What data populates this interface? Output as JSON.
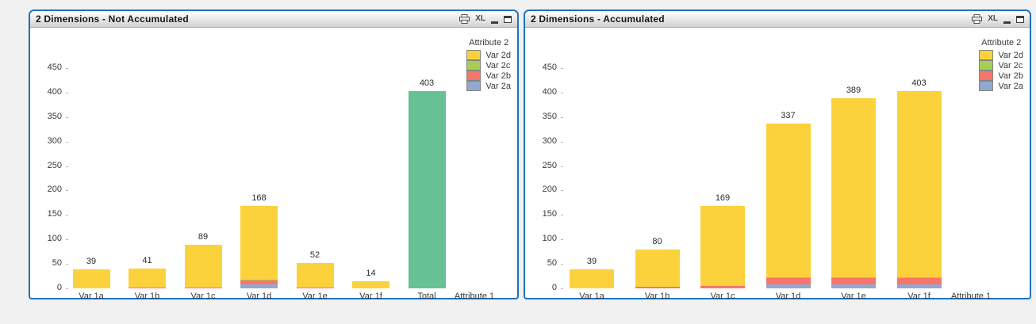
{
  "panels": [
    {
      "title": "2 Dimensions - Not Accumulated",
      "caption": {
        "xl_label": "XL"
      }
    },
    {
      "title": "2 Dimensions - Accumulated",
      "caption": {
        "xl_label": "XL"
      }
    }
  ],
  "chart_data": [
    {
      "type": "bar",
      "stacked": true,
      "title": "2 Dimensions - Not Accumulated",
      "xlabel": "Attribute 1",
      "ylabel": "",
      "ylim": [
        0,
        450
      ],
      "ytick_step": 50,
      "grid": false,
      "legend": {
        "title": "Attribute 2",
        "position": "top-right",
        "entries": [
          {
            "label": "Var 2d",
            "color": "#FCD23C"
          },
          {
            "label": "Var 2c",
            "color": "#A6CE53"
          },
          {
            "label": "Var 2b",
            "color": "#F7766B"
          },
          {
            "label": "Var 2a",
            "color": "#92A8CE"
          }
        ]
      },
      "series_colors": {
        "Var 2a": "#92A8CE",
        "Var 2b": "#F7766B",
        "Var 2c": "#A6CE53",
        "Var 2d": "#FCD23C",
        "Total": "#66C194"
      },
      "bars": [
        {
          "category": "Var 1a",
          "total": 39,
          "label": "39",
          "segments": [
            {
              "series": "Var 2d",
              "value": 39
            }
          ]
        },
        {
          "category": "Var 1b",
          "total": 41,
          "label": "41",
          "segments": [
            {
              "series": "Var 2b",
              "value": 2
            },
            {
              "series": "Var 2d",
              "value": 39
            }
          ]
        },
        {
          "category": "Var 1c",
          "total": 89,
          "label": "89",
          "segments": [
            {
              "series": "Var 2b",
              "value": 2
            },
            {
              "series": "Var 2d",
              "value": 87
            }
          ]
        },
        {
          "category": "Var 1d",
          "total": 168,
          "label": "168",
          "segments": [
            {
              "series": "Var 2a",
              "value": 8
            },
            {
              "series": "Var 2b",
              "value": 8
            },
            {
              "series": "Var 2c",
              "value": 2
            },
            {
              "series": "Var 2d",
              "value": 150
            }
          ]
        },
        {
          "category": "Var 1e",
          "total": 52,
          "label": "52",
          "segments": [
            {
              "series": "Var 2b",
              "value": 2
            },
            {
              "series": "Var 2d",
              "value": 50
            }
          ]
        },
        {
          "category": "Var 1f",
          "total": 14,
          "label": "14",
          "segments": [
            {
              "series": "Var 2d",
              "value": 14
            }
          ]
        },
        {
          "category": "Total",
          "total": 403,
          "label": "403",
          "segments": [
            {
              "series": "Total",
              "value": 403
            }
          ]
        }
      ]
    },
    {
      "type": "bar",
      "stacked": true,
      "title": "2 Dimensions - Accumulated",
      "xlabel": "Attribute 1",
      "ylabel": "",
      "ylim": [
        0,
        450
      ],
      "ytick_step": 50,
      "grid": false,
      "legend": {
        "title": "Attribute 2",
        "position": "top-right",
        "entries": [
          {
            "label": "Var 2d",
            "color": "#FCD23C"
          },
          {
            "label": "Var 2c",
            "color": "#A6CE53"
          },
          {
            "label": "Var 2b",
            "color": "#F7766B"
          },
          {
            "label": "Var 2a",
            "color": "#92A8CE"
          }
        ]
      },
      "series_colors": {
        "Var 2a": "#92A8CE",
        "Var 2b": "#F7766B",
        "Var 2c": "#A6CE53",
        "Var 2d": "#FCD23C"
      },
      "bars": [
        {
          "category": "Var 1a",
          "total": 39,
          "label": "39",
          "segments": [
            {
              "series": "Var 2d",
              "value": 39
            }
          ]
        },
        {
          "category": "Var 1b",
          "total": 80,
          "label": "80",
          "segments": [
            {
              "series": "Var 2b",
              "value": 3
            },
            {
              "series": "Var 2d",
              "value": 77
            }
          ]
        },
        {
          "category": "Var 1c",
          "total": 169,
          "label": "169",
          "segments": [
            {
              "series": "Var 2b",
              "value": 5
            },
            {
              "series": "Var 2d",
              "value": 164
            }
          ]
        },
        {
          "category": "Var 1d",
          "total": 337,
          "label": "337",
          "segments": [
            {
              "series": "Var 2a",
              "value": 8
            },
            {
              "series": "Var 2b",
              "value": 13
            },
            {
              "series": "Var 2c",
              "value": 2
            },
            {
              "series": "Var 2d",
              "value": 314
            }
          ]
        },
        {
          "category": "Var 1e",
          "total": 389,
          "label": "389",
          "segments": [
            {
              "series": "Var 2a",
              "value": 8
            },
            {
              "series": "Var 2b",
              "value": 13
            },
            {
              "series": "Var 2c",
              "value": 2
            },
            {
              "series": "Var 2d",
              "value": 366
            }
          ]
        },
        {
          "category": "Var 1f",
          "total": 403,
          "label": "403",
          "segments": [
            {
              "series": "Var 2a",
              "value": 8
            },
            {
              "series": "Var 2b",
              "value": 13
            },
            {
              "series": "Var 2c",
              "value": 2
            },
            {
              "series": "Var 2d",
              "value": 380
            }
          ]
        }
      ]
    }
  ]
}
